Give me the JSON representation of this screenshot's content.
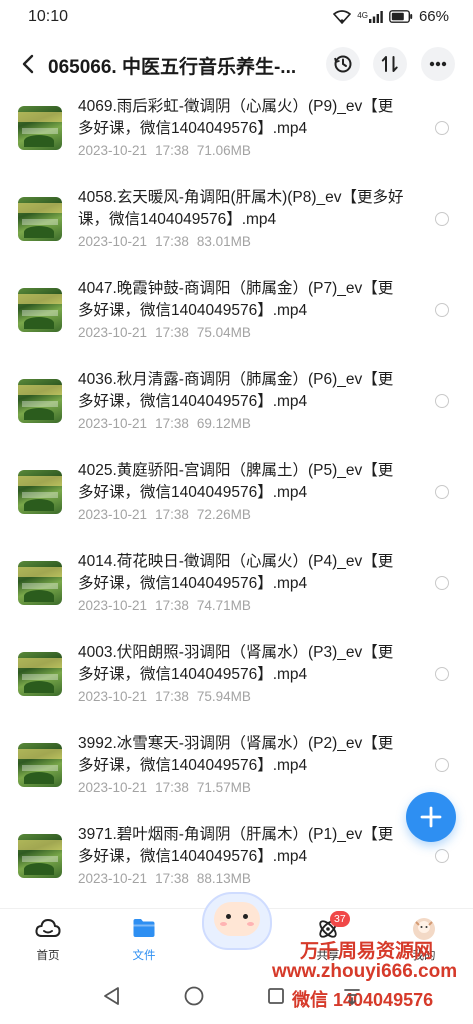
{
  "status_bar": {
    "time": "10:10",
    "network": "4G",
    "battery": "66%"
  },
  "header": {
    "title": "065066. 中医五行音乐养生-...",
    "actions": [
      "history-icon",
      "sort-icon",
      "more-icon"
    ]
  },
  "files": [
    {
      "name": "4069.雨后彩虹-徵调阴（心属火）(P9)_ev【更多好课，微信1404049576】.mp4",
      "date": "2023-10-21",
      "time": "17:38",
      "size": "71.06MB"
    },
    {
      "name": "4058.玄天暖风-角调阳(肝属木)(P8)_ev【更多好课，微信1404049576】.mp4",
      "date": "2023-10-21",
      "time": "17:38",
      "size": "83.01MB"
    },
    {
      "name": "4047.晚霞钟鼓-商调阳（肺属金）(P7)_ev【更多好课，微信1404049576】.mp4",
      "date": "2023-10-21",
      "time": "17:38",
      "size": "75.04MB"
    },
    {
      "name": "4036.秋月清露-商调阴（肺属金）(P6)_ev【更多好课，微信1404049576】.mp4",
      "date": "2023-10-21",
      "time": "17:38",
      "size": "69.12MB"
    },
    {
      "name": "4025.黄庭骄阳-宫调阳（脾属土）(P5)_ev【更多好课，微信1404049576】.mp4",
      "date": "2023-10-21",
      "time": "17:38",
      "size": "72.26MB"
    },
    {
      "name": "4014.荷花映日-徵调阳（心属火）(P4)_ev【更多好课，微信1404049576】.mp4",
      "date": "2023-10-21",
      "time": "17:38",
      "size": "74.71MB"
    },
    {
      "name": "4003.伏阳朗照-羽调阳（肾属水）(P3)_ev【更多好课，微信1404049576】.mp4",
      "date": "2023-10-21",
      "time": "17:38",
      "size": "75.94MB"
    },
    {
      "name": "3992.冰雪寒天-羽调阴（肾属水）(P2)_ev【更多好课，微信1404049576】.mp4",
      "date": "2023-10-21",
      "time": "17:38",
      "size": "71.57MB"
    },
    {
      "name": "3971.碧叶烟雨-角调阴（肝属木）(P1)_ev【更多好课，微信1404049576】.mp4",
      "date": "2023-10-21",
      "time": "17:38",
      "size": "88.13MB"
    }
  ],
  "bottom_nav": {
    "home": "首页",
    "files": "文件",
    "share": "共享",
    "share_badge": "37",
    "mine": "我的"
  },
  "watermark": {
    "line1": "万千周易资源网",
    "line2": "www.zhouyi666.com",
    "line3": "微信 1404049576"
  },
  "colors": {
    "accent": "#2e8ff2",
    "badge": "#f04848",
    "watermark": "#d63a2a",
    "meta_text": "#a3a3a3"
  }
}
